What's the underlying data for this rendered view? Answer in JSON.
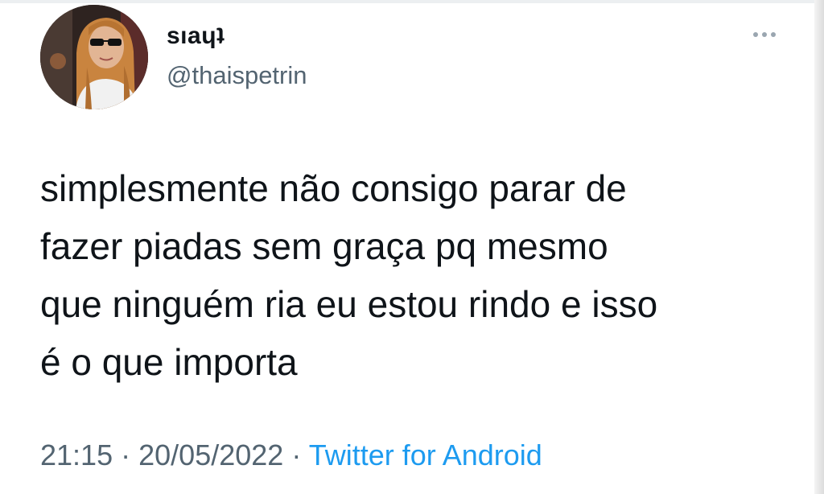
{
  "tweet": {
    "author": {
      "display_name": "sıaɥʇ",
      "handle": "@thaispetrin"
    },
    "more_icon": "more-horizontal-icon",
    "text": "simplesmente não consigo parar de\nfazer piadas sem graça pq mesmo\nque ninguém ria eu estou rindo e isso\né o que importa",
    "time": "21:15",
    "date": "20/05/2022",
    "source": "Twitter for Android",
    "separator": "·"
  },
  "colors": {
    "text_primary": "#0f1419",
    "text_secondary": "#536471",
    "link": "#1d9bf0"
  }
}
